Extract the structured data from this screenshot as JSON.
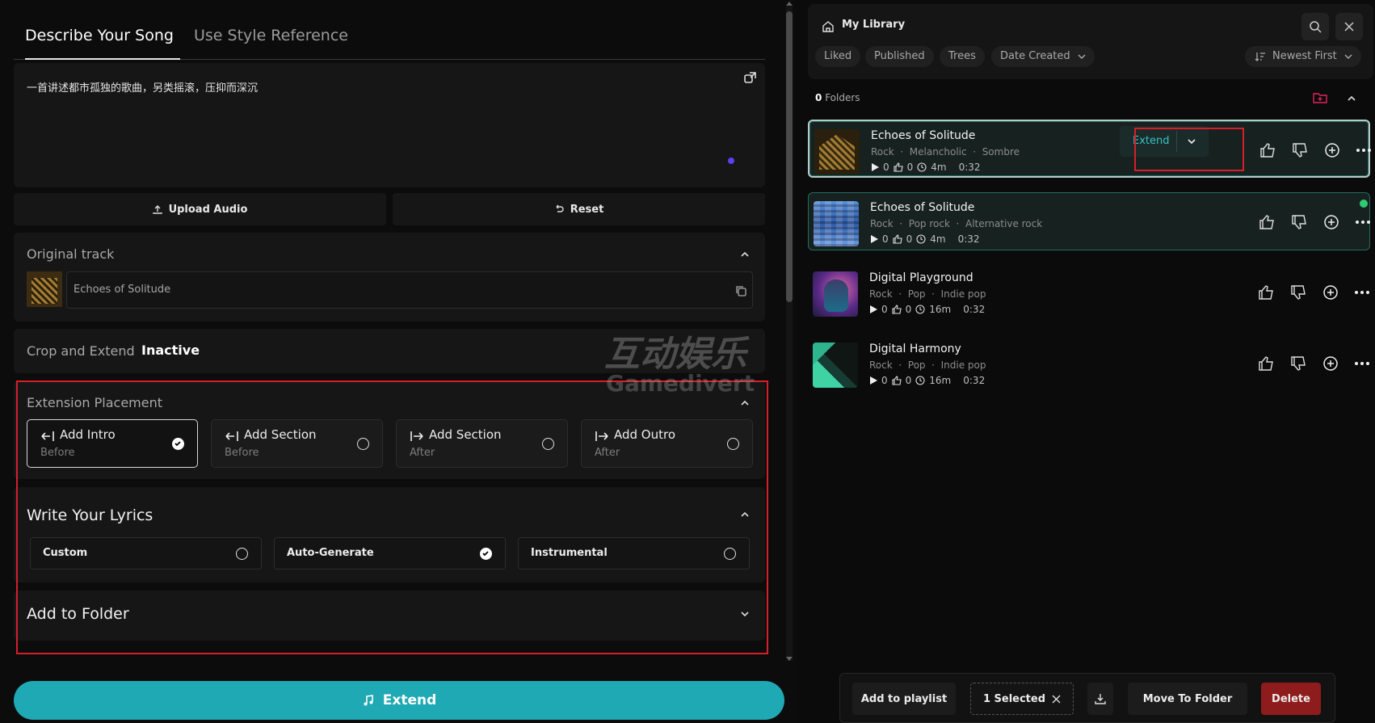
{
  "left": {
    "tabs": [
      "Describe Your Song",
      "Use Style Reference"
    ],
    "prompt": "一首讲述都市孤独的歌曲，另类摇滚，压抑而深沉",
    "upload_label": "Upload Audio",
    "reset_label": "Reset",
    "original_track": {
      "title": "Original track",
      "name": "Echoes of Solitude"
    },
    "crop": {
      "label": "Crop and Extend",
      "status": "Inactive"
    },
    "placement": {
      "title": "Extension Placement",
      "options": [
        {
          "label": "Add Intro",
          "sub": "Before",
          "icon": "arrow-left-bar-icon",
          "selected": true
        },
        {
          "label": "Add Section",
          "sub": "Before",
          "icon": "arrow-left-bar-icon",
          "selected": false
        },
        {
          "label": "Add Section",
          "sub": "After",
          "icon": "bar-arrow-right-icon",
          "selected": false
        },
        {
          "label": "Add Outro",
          "sub": "After",
          "icon": "bar-arrow-right-icon",
          "selected": false
        }
      ]
    },
    "lyrics": {
      "title": "Write Your Lyrics",
      "options": [
        {
          "label": "Custom",
          "selected": false
        },
        {
          "label": "Auto-Generate",
          "selected": true
        },
        {
          "label": "Instrumental",
          "selected": false
        }
      ]
    },
    "folder": {
      "title": "Add to Folder"
    },
    "extend_label": "Extend",
    "watermark": {
      "cn": "互动娱乐",
      "en": "Gamedivert"
    }
  },
  "right": {
    "title": "My Library",
    "filters": [
      "Liked",
      "Published",
      "Trees",
      "Date Created"
    ],
    "sort": "Newest First",
    "folders_count": "0",
    "folders_label": "Folders",
    "songs": [
      {
        "title": "Echoes of Solitude",
        "tags": [
          "Rock",
          "Melancholic",
          "Sombre"
        ],
        "plays": "0",
        "likes": "0",
        "age": "4m",
        "duration": "0:32"
      },
      {
        "title": "Echoes of Solitude",
        "tags": [
          "Rock",
          "Pop rock",
          "Alternative rock"
        ],
        "plays": "0",
        "likes": "0",
        "age": "4m",
        "duration": "0:32"
      },
      {
        "title": "Digital Playground",
        "tags": [
          "Rock",
          "Pop",
          "Indie pop"
        ],
        "plays": "0",
        "likes": "0",
        "age": "16m",
        "duration": "0:32"
      },
      {
        "title": "Digital Harmony",
        "tags": [
          "Rock",
          "Pop",
          "Indie pop"
        ],
        "plays": "0",
        "likes": "0",
        "age": "16m",
        "duration": "0:32"
      }
    ],
    "extend_btn": "Extend",
    "bottom": {
      "add_playlist": "Add to playlist",
      "selected": "1 Selected",
      "move": "Move To Folder",
      "delete": "Delete"
    }
  },
  "colors": {
    "accent": "#1fa9b4",
    "highlight": "#d3202a",
    "delete": "#8f1c1c",
    "online": "#2ecc71"
  }
}
